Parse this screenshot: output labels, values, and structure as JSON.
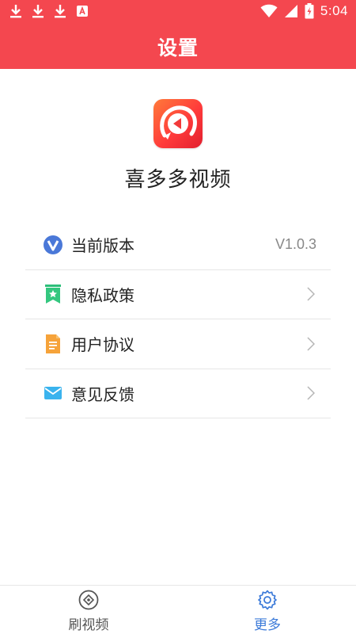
{
  "status_bar": {
    "time": "5:04",
    "icons": [
      "download-icon",
      "download-icon",
      "download-icon",
      "a-notification-icon",
      "wifi-icon",
      "signal-icon",
      "battery-icon"
    ]
  },
  "header": {
    "title": "设置"
  },
  "app": {
    "name": "喜多多视频",
    "logo_icon": "play-logo-icon"
  },
  "settings": {
    "items": [
      {
        "label": "当前版本",
        "value": "V1.0.3",
        "icon": "version-v-icon"
      },
      {
        "label": "隐私政策",
        "icon": "privacy-bookmark-icon"
      },
      {
        "label": "用户协议",
        "icon": "agreement-document-icon"
      },
      {
        "label": "意见反馈",
        "icon": "feedback-mail-icon"
      }
    ]
  },
  "bottom_nav": {
    "items": [
      {
        "label": "刷视频",
        "icon": "play-circle-icon",
        "active": false
      },
      {
        "label": "更多",
        "icon": "gear-icon",
        "active": true
      }
    ]
  },
  "colors": {
    "brand": "#f4474f",
    "active": "#3d7bd9",
    "inactive": "#555555"
  }
}
